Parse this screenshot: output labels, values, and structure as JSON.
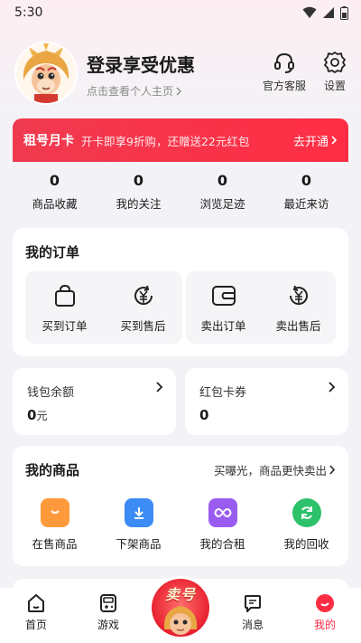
{
  "status": {
    "time": "5:30"
  },
  "profile": {
    "title": "登录享受优惠",
    "subtitle": "点击查看个人主页",
    "actions": [
      {
        "label": "官方客服",
        "icon": "headset-icon"
      },
      {
        "label": "设置",
        "icon": "gear-icon"
      }
    ]
  },
  "vip": {
    "title": "租号月卡",
    "desc": "开卡即享9折购，还赠送22元红包",
    "cta": "去开通"
  },
  "stats": [
    {
      "value": "0",
      "label": "商品收藏"
    },
    {
      "value": "0",
      "label": "我的关注"
    },
    {
      "value": "0",
      "label": "浏览足迹"
    },
    {
      "value": "0",
      "label": "最近来访"
    }
  ],
  "orders": {
    "title": "我的订单",
    "items": [
      {
        "label": "买到订单",
        "icon": "shopping-bag-icon"
      },
      {
        "label": "买到售后",
        "icon": "yen-refund-icon"
      },
      {
        "label": "卖出订单",
        "icon": "wallet-icon"
      },
      {
        "label": "卖出售后",
        "icon": "yen-return-icon"
      }
    ]
  },
  "wallet": {
    "balance_label": "钱包余额",
    "balance_value": "0",
    "balance_unit": "元",
    "coupon_label": "红包卡券",
    "coupon_value": "0"
  },
  "goods": {
    "title": "我的商品",
    "link": "买曝光，商品更快卖出",
    "items": [
      {
        "label": "在售商品",
        "icon": "on-sale-icon",
        "color": "#ff9a3c"
      },
      {
        "label": "下架商品",
        "icon": "download-icon",
        "color": "#3d8cf5"
      },
      {
        "label": "我的合租",
        "icon": "infinity-icon",
        "color": "#9a5cf0"
      },
      {
        "label": "我的回收",
        "icon": "refresh-icon",
        "color": "#2cc26a"
      }
    ]
  },
  "tabbar": {
    "items": [
      {
        "label": "首页",
        "icon": "home-icon"
      },
      {
        "label": "游戏",
        "icon": "gamepad-icon"
      },
      {
        "label": "",
        "icon": "sell-badge-icon"
      },
      {
        "label": "消息",
        "icon": "message-icon"
      },
      {
        "label": "我的",
        "icon": "profile-icon",
        "active": true
      }
    ],
    "center_badge": "卖号"
  },
  "colors": {
    "accent": "#ff2d44",
    "banner": "#f03a4f"
  }
}
